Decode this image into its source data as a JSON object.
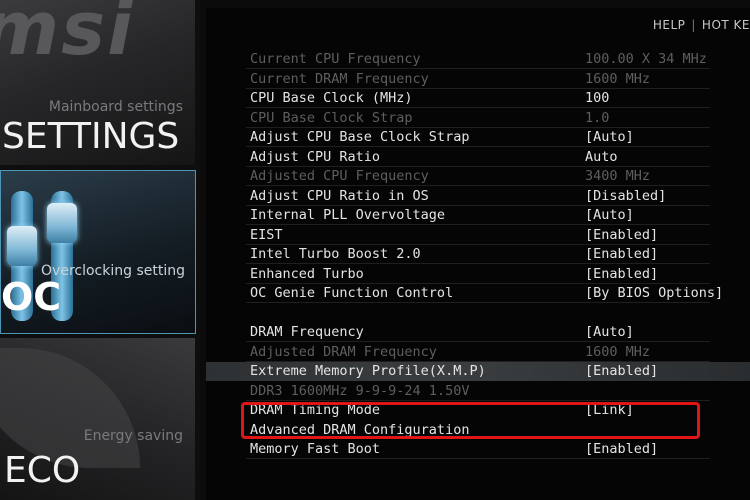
{
  "sidebar": {
    "logo_text": "msi",
    "panels": [
      {
        "subtitle": "Mainboard settings",
        "title": "SETTINGS"
      },
      {
        "subtitle": "Overclocking setting",
        "title": "OC"
      },
      {
        "subtitle": "Energy saving",
        "title": "ECO"
      }
    ]
  },
  "help_bar": {
    "help": "HELP",
    "separator": "|",
    "hotkey": "HOT KE"
  },
  "rows": [
    {
      "label": "Current CPU Frequency",
      "value": "100.00 X 34 MHz"
    },
    {
      "label": "Current DRAM Frequency",
      "value": "1600 MHz"
    },
    {
      "label": "CPU Base Clock (MHz)",
      "value": "100"
    },
    {
      "label": "CPU Base Clock Strap",
      "value": "1.0"
    },
    {
      "label": "Adjust CPU Base Clock Strap",
      "value": "[Auto]"
    },
    {
      "label": "Adjust CPU Ratio",
      "value": "Auto"
    },
    {
      "label": "Adjusted CPU Frequency",
      "value": "3400 MHz"
    },
    {
      "label": "Adjust CPU Ratio in OS",
      "value": "[Disabled]"
    },
    {
      "label": "Internal PLL Overvoltage",
      "value": "[Auto]"
    },
    {
      "label": "EIST",
      "value": "[Enabled]"
    },
    {
      "label": "Intel Turbo Boost 2.0",
      "value": "[Enabled]"
    },
    {
      "label": "Enhanced Turbo",
      "value": "[Enabled]"
    },
    {
      "label": "OC Genie Function Control",
      "value": "[By BIOS Options]"
    },
    {
      "label": "DRAM Frequency",
      "value": "[Auto]"
    },
    {
      "label": "Adjusted DRAM Frequency",
      "value": "1600 MHz"
    },
    {
      "label": "Extreme Memory Profile(X.M.P)",
      "value": "[Enabled]"
    },
    {
      "label": "DDR3 1600MHz 9-9-9-24 1.50V",
      "value": ""
    },
    {
      "label": "DRAM Timing Mode",
      "value": "[Link]"
    },
    {
      "label": "Advanced DRAM Configuration",
      "value": ""
    },
    {
      "label": "Memory Fast Boot",
      "value": "[Enabled]"
    }
  ]
}
